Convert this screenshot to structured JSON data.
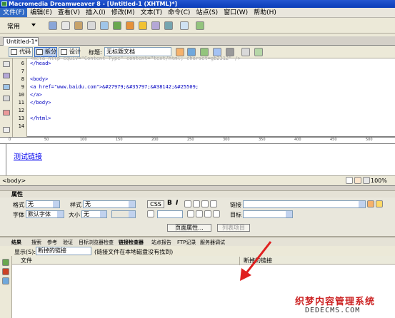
{
  "window": {
    "title": "Macromedia Dreamweaver 8 - [Untitled-1 (XHTML)*]"
  },
  "menu": [
    "文件(F)",
    "编辑(E)",
    "查看(V)",
    "插入(I)",
    "修改(M)",
    "文本(T)",
    "命令(C)",
    "站点(S)",
    "窗口(W)",
    "帮助(H)"
  ],
  "insert_bar": {
    "category": "常用"
  },
  "document_tab": {
    "label": "Untitled-1*"
  },
  "doc_toolbar": {
    "code_label": "代码",
    "split_label": "拆分",
    "design_label": "设计",
    "title_label": "标题:",
    "title_value": "无标题文档"
  },
  "code": {
    "line_numbers": [
      "6",
      "7",
      "8",
      "9",
      "10",
      "11",
      "12",
      "13",
      "14"
    ],
    "lines": [
      "</head>",
      "",
      "<body>",
      "<a href=\"www.baidu.com\">&#27979;&#35797;&#38142;&#25509;",
      "</a>",
      "</body>",
      "",
      "</html>",
      ""
    ],
    "partial_top": "<meta http-equiv=\"Content-Type\" content=\"text/html; charset=gb2312\" />"
  },
  "ruler": [
    "0",
    "50",
    "100",
    "150",
    "200",
    "250",
    "300",
    "350",
    "400",
    "450",
    "500"
  ],
  "design": {
    "link_text": "测试链接"
  },
  "status": {
    "tag": "<body>",
    "zoom": "100%"
  },
  "properties": {
    "header": "属性",
    "format_label": "格式",
    "format_value": "无",
    "style_label": "样式",
    "style_value": "无",
    "css_button": "CSS",
    "bold": "B",
    "italic": "I",
    "link_label": "链接",
    "font_label": "字体",
    "font_value": "默认字体",
    "size_label": "大小",
    "size_value": "无",
    "target_label": "目标",
    "page_props_button": "页面属性...",
    "list_item_button": "列表项目"
  },
  "results": {
    "tabs": [
      "结果",
      "搜索",
      "参考",
      "验证",
      "目标浏览器检查",
      "链接检查器",
      "站点报告",
      "FTP记录",
      "服务器调试"
    ],
    "show_label": "显示(S):",
    "show_value": "断掉的链接",
    "note": "(链接文件在本地磁盘没有找到)",
    "col_file": "文件",
    "col_broken": "断掉的链接"
  },
  "watermark": {
    "line1": "织梦内容管理系统",
    "line2": "DEDECMS.COM"
  },
  "colors": {
    "title_bar": "#0a3cb8",
    "link": "#0000ee",
    "arrow": "#e02020",
    "watermark_red": "#cc2222"
  }
}
